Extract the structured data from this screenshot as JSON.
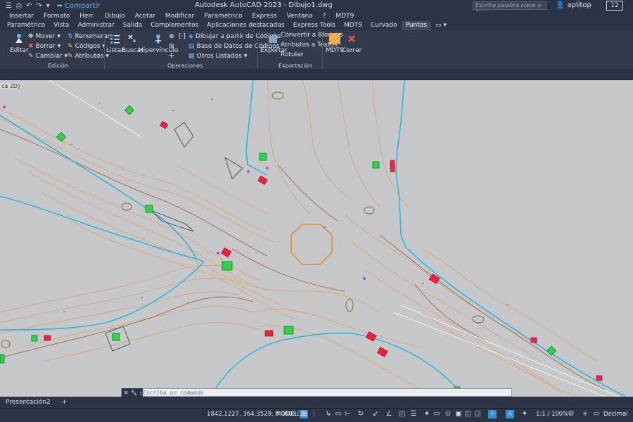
{
  "app": {
    "title": "Autodesk AutoCAD 2023 - Dibujo1.dwg",
    "share_label": "Compartir",
    "search_placeholder": "Escriba palabra clave o frase",
    "user_name": "aplitop",
    "notifications_count": "12"
  },
  "menus": [
    "Insertar",
    "Formato",
    "Herr.",
    "Dibujo",
    "Acotar",
    "Modificar",
    "Paramétrico",
    "Express",
    "Ventana",
    "?",
    "MDT9"
  ],
  "ribbon_tabs": [
    "Paramétrico",
    "Vista",
    "Administrar",
    "Salida",
    "Complementos",
    "Aplicaciones destacadas",
    "Express Tools",
    "MDT9",
    "Curvado",
    "Puntos"
  ],
  "active_tab": "Puntos",
  "panels": {
    "edicion": {
      "label": "Edición",
      "editar": "Editar",
      "mover": "Mover",
      "borrar": "Borrar",
      "cambiar": "Cambiar",
      "renumerar": "Renumerar",
      "codigos": "Códigos",
      "atributos": "Atributos"
    },
    "operaciones": {
      "label": "Operaciones",
      "listar": "Listar",
      "buscar": "Buscar",
      "hipervinculo": "Hipervínculo",
      "dibujar_codigos": "Dibujar a partir de Códigos",
      "base_datos": "Base de Datos de Códigos",
      "otros_listados": "Otros Listados"
    },
    "exportacion": {
      "label": "Exportación",
      "exportar": "Exportar",
      "convertir_bloques": "Convertir a Bloques",
      "atributos_textos": "Atributos a Textos",
      "rotular": "Rotular"
    },
    "mdt9": {
      "mdt9": "MDT9",
      "cerrar": "Cerrar"
    }
  },
  "viewport_label": "ca 2D]",
  "command_placeholder": "Escriba un comando",
  "layout_tab": "Presentación2",
  "status": {
    "coords": "1842.1227, 364.3529, 0.0000",
    "model": "MODELO",
    "scale": "1:1 / 100%",
    "units": "Decimal"
  },
  "colors": {
    "canvas": "#c7c8c9",
    "road_edge": "#19b3e6",
    "contour": "#e3a36e",
    "contour_dark": "#a4633a",
    "point_red": "#ff1e3c",
    "point_green": "#27d84a"
  }
}
